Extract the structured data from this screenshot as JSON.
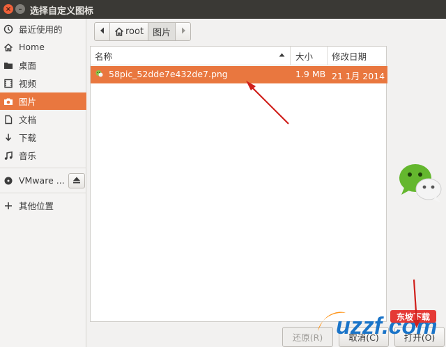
{
  "window": {
    "title": "选择自定义图标"
  },
  "sidebar": {
    "items": [
      {
        "label": "最近使用的",
        "icon": "clock-icon"
      },
      {
        "label": "Home",
        "icon": "home-icon"
      },
      {
        "label": "桌面",
        "icon": "folder-icon"
      },
      {
        "label": "视频",
        "icon": "video-icon"
      },
      {
        "label": "图片",
        "icon": "camera-icon",
        "active": true
      },
      {
        "label": "文档",
        "icon": "document-icon"
      },
      {
        "label": "下载",
        "icon": "download-icon"
      },
      {
        "label": "音乐",
        "icon": "music-icon"
      }
    ],
    "device": {
      "label": "VMware ...",
      "icon": "disc-icon",
      "eject_icon": "eject-icon"
    },
    "other": {
      "label": "其他位置",
      "icon": "plus-icon"
    }
  },
  "pathbar": {
    "back_icon": "chevron-left-icon",
    "forward_icon": "chevron-right-icon",
    "crumbs": [
      {
        "label": "root",
        "icon": "home-icon"
      },
      {
        "label": "图片",
        "current": true
      }
    ]
  },
  "filelist": {
    "columns": {
      "name": "名称",
      "size": "大小",
      "modified": "修改日期"
    },
    "sort_icon": "sort-ascending-icon",
    "rows": [
      {
        "name": "58pic_52dde7e432de7.png",
        "size": "1.9 MB",
        "modified": "21 1月 2014",
        "icon": "image-file-icon",
        "selected": true
      }
    ]
  },
  "buttons": {
    "revert": "还原(R)",
    "cancel": "取消(C)",
    "open": "打开(O)"
  },
  "watermark": {
    "brand": "uzzf.com",
    "tagline": "东坡下载"
  },
  "colors": {
    "accent": "#e9773f",
    "titlebar": "#3a3935",
    "annotation": "#d0201c"
  }
}
